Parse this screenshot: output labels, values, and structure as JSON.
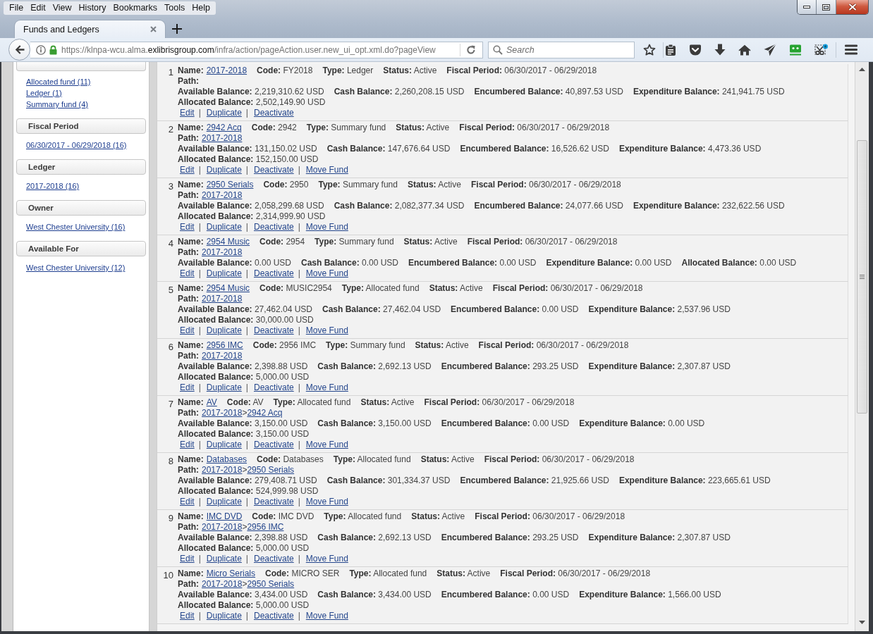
{
  "menu_bar": [
    "File",
    "Edit",
    "View",
    "History",
    "Bookmarks",
    "Tools",
    "Help"
  ],
  "tabs": [
    {
      "label": "Funds and Ledgers",
      "selected": true
    }
  ],
  "address_bar": {
    "url_prefix": "https://klnpa-wcu.alma.",
    "url_host": "exlibrisgroup.com",
    "url_path": "/infra/action/pageAction.user.new_ui_opt.xml.do?pageView"
  },
  "search": {
    "placeholder": "Search"
  },
  "sidebar": {
    "groups": [
      {
        "items": [
          "Allocated fund (11)",
          "Ledger (1)",
          "Summary fund (4)"
        ]
      },
      {
        "title": "Fiscal Period",
        "items": [
          "06/30/2017 - 06/29/2018 (16)"
        ]
      },
      {
        "title": "Ledger",
        "items": [
          "2017-2018 (16)"
        ]
      },
      {
        "title": "Owner",
        "items": [
          "West Chester University (16)"
        ]
      },
      {
        "title": "Available For",
        "items": [
          "West Chester University (12)"
        ]
      }
    ]
  },
  "records": [
    {
      "index": "1",
      "fields": [
        {
          "kind": "link",
          "label": "Name:",
          "value": "2017-2018"
        },
        {
          "kind": "text",
          "label": "Code:",
          "value": "FY2018"
        },
        {
          "kind": "text",
          "label": "Type:",
          "value": "Ledger"
        },
        {
          "kind": "text",
          "label": "Status:",
          "value": "Active"
        },
        {
          "kind": "text",
          "label": "Fiscal Period:",
          "value": "06/30/2017 - 06/29/2018"
        }
      ],
      "path": {
        "label": "Path:"
      },
      "balances": [
        {
          "label": "Available Balance:",
          "value": "2,219,310.62 USD"
        },
        {
          "label": "Cash Balance:",
          "value": "2,260,208.15 USD"
        },
        {
          "label": "Encumbered Balance:",
          "value": "40,897.53 USD"
        },
        {
          "label": "Expenditure Balance:",
          "value": "241,941.75 USD"
        },
        {
          "label": "Allocated Balance:",
          "value": "2,502,149.90 USD"
        }
      ],
      "actions": [
        {
          "text": "Edit",
          "sep": "|"
        },
        {
          "text": "Duplicate",
          "sep": "|"
        },
        {
          "text": "Deactivate"
        }
      ]
    },
    {
      "index": "2",
      "fields": [
        {
          "kind": "link",
          "label": "Name:",
          "value": "2942 Acq"
        },
        {
          "kind": "text",
          "label": "Code:",
          "value": "2942"
        },
        {
          "kind": "text",
          "label": "Type:",
          "value": "Summary fund"
        },
        {
          "kind": "text",
          "label": "Status:",
          "value": "Active"
        },
        {
          "kind": "text",
          "label": "Fiscal Period:",
          "value": "06/30/2017 - 06/29/2018"
        }
      ],
      "path": {
        "label": "Path:",
        "links": [
          {
            "text": "2017-2018"
          }
        ]
      },
      "balances": [
        {
          "label": "Available Balance:",
          "value": "131,150.02 USD"
        },
        {
          "label": "Cash Balance:",
          "value": "147,676.64 USD"
        },
        {
          "label": "Encumbered Balance:",
          "value": "16,526.62 USD"
        },
        {
          "label": "Expenditure Balance:",
          "value": "4,473.36 USD"
        },
        {
          "label": "Allocated Balance:",
          "value": "152,150.00 USD"
        }
      ],
      "actions": [
        {
          "text": "Edit",
          "sep": "|"
        },
        {
          "text": "Duplicate",
          "sep": "|"
        },
        {
          "text": "Deactivate",
          "sep": "|"
        },
        {
          "text": "Move Fund"
        }
      ]
    },
    {
      "index": "3",
      "fields": [
        {
          "kind": "link",
          "label": "Name:",
          "value": "2950 Serials"
        },
        {
          "kind": "text",
          "label": "Code:",
          "value": "2950"
        },
        {
          "kind": "text",
          "label": "Type:",
          "value": "Summary fund"
        },
        {
          "kind": "text",
          "label": "Status:",
          "value": "Active"
        },
        {
          "kind": "text",
          "label": "Fiscal Period:",
          "value": "06/30/2017 - 06/29/2018"
        }
      ],
      "path": {
        "label": "Path:",
        "links": [
          {
            "text": "2017-2018"
          }
        ]
      },
      "balances": [
        {
          "label": "Available Balance:",
          "value": "2,058,299.68 USD"
        },
        {
          "label": "Cash Balance:",
          "value": "2,082,377.34 USD"
        },
        {
          "label": "Encumbered Balance:",
          "value": "24,077.66 USD"
        },
        {
          "label": "Expenditure Balance:",
          "value": "232,622.56 USD"
        },
        {
          "label": "Allocated Balance:",
          "value": "2,314,999.90 USD"
        }
      ],
      "actions": [
        {
          "text": "Edit",
          "sep": "|"
        },
        {
          "text": "Duplicate",
          "sep": "|"
        },
        {
          "text": "Deactivate",
          "sep": "|"
        },
        {
          "text": "Move Fund"
        }
      ]
    },
    {
      "index": "4",
      "fields": [
        {
          "kind": "link",
          "label": "Name:",
          "value": "2954 Music"
        },
        {
          "kind": "text",
          "label": "Code:",
          "value": "2954"
        },
        {
          "kind": "text",
          "label": "Type:",
          "value": "Summary fund"
        },
        {
          "kind": "text",
          "label": "Status:",
          "value": "Active"
        },
        {
          "kind": "text",
          "label": "Fiscal Period:",
          "value": "06/30/2017 - 06/29/2018"
        }
      ],
      "path": {
        "label": "Path:",
        "links": [
          {
            "text": "2017-2018"
          }
        ]
      },
      "balances": [
        {
          "label": "Available Balance:",
          "value": "0.00 USD"
        },
        {
          "label": "Cash Balance:",
          "value": "0.00 USD"
        },
        {
          "label": "Encumbered Balance:",
          "value": "0.00 USD"
        },
        {
          "label": "Expenditure Balance:",
          "value": "0.00 USD"
        },
        {
          "label": "Allocated Balance:",
          "value": "0.00 USD"
        }
      ],
      "actions": [
        {
          "text": "Edit",
          "sep": "|"
        },
        {
          "text": "Duplicate",
          "sep": "|"
        },
        {
          "text": "Deactivate",
          "sep": "|"
        },
        {
          "text": "Move Fund"
        }
      ]
    },
    {
      "index": "5",
      "fields": [
        {
          "kind": "link",
          "label": "Name:",
          "value": "2954 Music"
        },
        {
          "kind": "text",
          "label": "Code:",
          "value": "MUSIC2954"
        },
        {
          "kind": "text",
          "label": "Type:",
          "value": "Allocated fund"
        },
        {
          "kind": "text",
          "label": "Status:",
          "value": "Active"
        },
        {
          "kind": "text",
          "label": "Fiscal Period:",
          "value": "06/30/2017 - 06/29/2018"
        }
      ],
      "path": {
        "label": "Path:",
        "links": [
          {
            "text": "2017-2018"
          }
        ]
      },
      "balances": [
        {
          "label": "Available Balance:",
          "value": "27,462.04 USD"
        },
        {
          "label": "Cash Balance:",
          "value": "27,462.04 USD"
        },
        {
          "label": "Encumbered Balance:",
          "value": "0.00 USD"
        },
        {
          "label": "Expenditure Balance:",
          "value": "2,537.96 USD"
        },
        {
          "label": "Allocated Balance:",
          "value": "30,000.00 USD"
        }
      ],
      "actions": [
        {
          "text": "Edit",
          "sep": "|"
        },
        {
          "text": "Duplicate",
          "sep": "|"
        },
        {
          "text": "Deactivate",
          "sep": "|"
        },
        {
          "text": "Move Fund"
        }
      ]
    },
    {
      "index": "6",
      "fields": [
        {
          "kind": "link",
          "label": "Name:",
          "value": "2956 IMC"
        },
        {
          "kind": "text",
          "label": "Code:",
          "value": "2956 IMC"
        },
        {
          "kind": "text",
          "label": "Type:",
          "value": "Summary fund"
        },
        {
          "kind": "text",
          "label": "Status:",
          "value": "Active"
        },
        {
          "kind": "text",
          "label": "Fiscal Period:",
          "value": "06/30/2017 - 06/29/2018"
        }
      ],
      "path": {
        "label": "Path:",
        "links": [
          {
            "text": "2017-2018"
          }
        ]
      },
      "balances": [
        {
          "label": "Available Balance:",
          "value": "2,398.88 USD"
        },
        {
          "label": "Cash Balance:",
          "value": "2,692.13 USD"
        },
        {
          "label": "Encumbered Balance:",
          "value": "293.25 USD"
        },
        {
          "label": "Expenditure Balance:",
          "value": "2,307.87 USD"
        },
        {
          "label": "Allocated Balance:",
          "value": "5,000.00 USD"
        }
      ],
      "actions": [
        {
          "text": "Edit",
          "sep": "|"
        },
        {
          "text": "Duplicate",
          "sep": "|"
        },
        {
          "text": "Deactivate",
          "sep": "|"
        },
        {
          "text": "Move Fund"
        }
      ]
    },
    {
      "index": "7",
      "fields": [
        {
          "kind": "link",
          "label": "Name:",
          "value": "AV"
        },
        {
          "kind": "text",
          "label": "Code:",
          "value": "AV"
        },
        {
          "kind": "text",
          "label": "Type:",
          "value": "Allocated fund"
        },
        {
          "kind": "text",
          "label": "Status:",
          "value": "Active"
        },
        {
          "kind": "text",
          "label": "Fiscal Period:",
          "value": "06/30/2017 - 06/29/2018"
        }
      ],
      "path": {
        "label": "Path:",
        "links": [
          {
            "text": "2017-2018",
            "sep": ">"
          },
          {
            "text": "2942 Acq"
          }
        ]
      },
      "balances": [
        {
          "label": "Available Balance:",
          "value": "3,150.00 USD"
        },
        {
          "label": "Cash Balance:",
          "value": "3,150.00 USD"
        },
        {
          "label": "Encumbered Balance:",
          "value": "0.00 USD"
        },
        {
          "label": "Expenditure Balance:",
          "value": "0.00 USD"
        },
        {
          "label": "Allocated Balance:",
          "value": "3,150.00 USD"
        }
      ],
      "actions": [
        {
          "text": "Edit",
          "sep": "|"
        },
        {
          "text": "Duplicate",
          "sep": "|"
        },
        {
          "text": "Deactivate",
          "sep": "|"
        },
        {
          "text": "Move Fund"
        }
      ]
    },
    {
      "index": "8",
      "fields": [
        {
          "kind": "link",
          "label": "Name:",
          "value": "Databases"
        },
        {
          "kind": "text",
          "label": "Code:",
          "value": "Databases"
        },
        {
          "kind": "text",
          "label": "Type:",
          "value": "Allocated fund"
        },
        {
          "kind": "text",
          "label": "Status:",
          "value": "Active"
        },
        {
          "kind": "text",
          "label": "Fiscal Period:",
          "value": "06/30/2017 - 06/29/2018"
        }
      ],
      "path": {
        "label": "Path:",
        "links": [
          {
            "text": "2017-2018",
            "sep": ">"
          },
          {
            "text": "2950 Serials"
          }
        ]
      },
      "balances": [
        {
          "label": "Available Balance:",
          "value": "279,408.71 USD"
        },
        {
          "label": "Cash Balance:",
          "value": "301,334.37 USD"
        },
        {
          "label": "Encumbered Balance:",
          "value": "21,925.66 USD"
        },
        {
          "label": "Expenditure Balance:",
          "value": "223,665.61 USD"
        },
        {
          "label": "Allocated Balance:",
          "value": "524,999.98 USD"
        }
      ],
      "actions": [
        {
          "text": "Edit",
          "sep": "|"
        },
        {
          "text": "Duplicate",
          "sep": "|"
        },
        {
          "text": "Deactivate",
          "sep": "|"
        },
        {
          "text": "Move Fund"
        }
      ]
    },
    {
      "index": "9",
      "fields": [
        {
          "kind": "link",
          "label": "Name:",
          "value": "IMC DVD"
        },
        {
          "kind": "text",
          "label": "Code:",
          "value": "IMC DVD"
        },
        {
          "kind": "text",
          "label": "Type:",
          "value": "Allocated fund"
        },
        {
          "kind": "text",
          "label": "Status:",
          "value": "Active"
        },
        {
          "kind": "text",
          "label": "Fiscal Period:",
          "value": "06/30/2017 - 06/29/2018"
        }
      ],
      "path": {
        "label": "Path:",
        "links": [
          {
            "text": "2017-2018",
            "sep": ">"
          },
          {
            "text": "2956 IMC"
          }
        ]
      },
      "balances": [
        {
          "label": "Available Balance:",
          "value": "2,398.88 USD"
        },
        {
          "label": "Cash Balance:",
          "value": "2,692.13 USD"
        },
        {
          "label": "Encumbered Balance:",
          "value": "293.25 USD"
        },
        {
          "label": "Expenditure Balance:",
          "value": "2,307.87 USD"
        },
        {
          "label": "Allocated Balance:",
          "value": "5,000.00 USD"
        }
      ],
      "actions": [
        {
          "text": "Edit",
          "sep": "|"
        },
        {
          "text": "Duplicate",
          "sep": "|"
        },
        {
          "text": "Deactivate",
          "sep": "|"
        },
        {
          "text": "Move Fund"
        }
      ]
    },
    {
      "index": "10",
      "fields": [
        {
          "kind": "link",
          "label": "Name:",
          "value": "Micro Serials"
        },
        {
          "kind": "text",
          "label": "Code:",
          "value": "MICRO SER"
        },
        {
          "kind": "text",
          "label": "Type:",
          "value": "Allocated fund"
        },
        {
          "kind": "text",
          "label": "Status:",
          "value": "Active"
        },
        {
          "kind": "text",
          "label": "Fiscal Period:",
          "value": "06/30/2017 - 06/29/2018"
        }
      ],
      "path": {
        "label": "Path:",
        "links": [
          {
            "text": "2017-2018",
            "sep": ">"
          },
          {
            "text": "2950 Serials"
          }
        ]
      },
      "balances": [
        {
          "label": "Available Balance:",
          "value": "3,434.00 USD"
        },
        {
          "label": "Cash Balance:",
          "value": "3,434.00 USD"
        },
        {
          "label": "Encumbered Balance:",
          "value": "0.00 USD"
        },
        {
          "label": "Expenditure Balance:",
          "value": "1,566.00 USD"
        },
        {
          "label": "Allocated Balance:",
          "value": "5,000.00 USD"
        }
      ],
      "actions": [
        {
          "text": "Edit",
          "sep": "|"
        },
        {
          "text": "Duplicate",
          "sep": "|"
        },
        {
          "text": "Deactivate",
          "sep": "|"
        },
        {
          "text": "Move Fund"
        }
      ]
    }
  ]
}
